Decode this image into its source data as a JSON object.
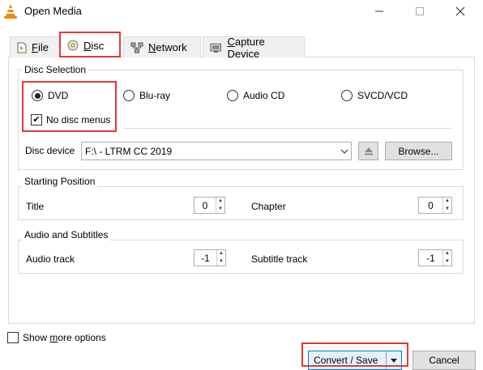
{
  "window": {
    "title": "Open Media",
    "icons": {
      "app": "vlc-cone-icon",
      "minimize": "minimize-icon",
      "maximize": "maximize-icon",
      "close": "close-icon"
    }
  },
  "tabs": [
    {
      "label_pre": "",
      "label_ul": "F",
      "label_post": "ile",
      "icon": "file-icon"
    },
    {
      "label_pre": "",
      "label_ul": "D",
      "label_post": "isc",
      "icon": "disc-icon",
      "active": true
    },
    {
      "label_pre": "",
      "label_ul": "N",
      "label_post": "etwork",
      "icon": "network-icon"
    },
    {
      "label_pre": "",
      "label_ul": "C",
      "label_post": "apture Device",
      "icon": "capture-device-icon"
    }
  ],
  "disc_selection": {
    "title": "Disc Selection",
    "options": [
      {
        "label": "DVD",
        "selected": true
      },
      {
        "label": "Blu-ray",
        "selected": false
      },
      {
        "label": "Audio CD",
        "selected": false
      },
      {
        "label": "SVCD/VCD",
        "selected": false
      }
    ],
    "no_disc_menus": {
      "label": "No disc menus",
      "checked": true
    },
    "device_label": "Disc device",
    "device_value": "F:\\ - LTRM CC 2019",
    "browse_label": "Browse..."
  },
  "starting_position": {
    "title": "Starting Position",
    "title_label": "Title",
    "title_value": "0",
    "chapter_label": "Chapter",
    "chapter_value": "0"
  },
  "audio_subtitles": {
    "title": "Audio and Subtitles",
    "audio_label": "Audio track",
    "audio_value": "-1",
    "subtitle_label": "Subtitle track",
    "subtitle_value": "-1"
  },
  "footer": {
    "show_more_pre": "Show ",
    "show_more_ul": "m",
    "show_more_post": "ore options",
    "show_more_checked": false,
    "convert_label": "Convert / Save",
    "cancel_label": "Cancel"
  },
  "colors": {
    "highlight": "#e53935",
    "accent": "#0078d7",
    "vlc_orange": "#f48b00"
  }
}
